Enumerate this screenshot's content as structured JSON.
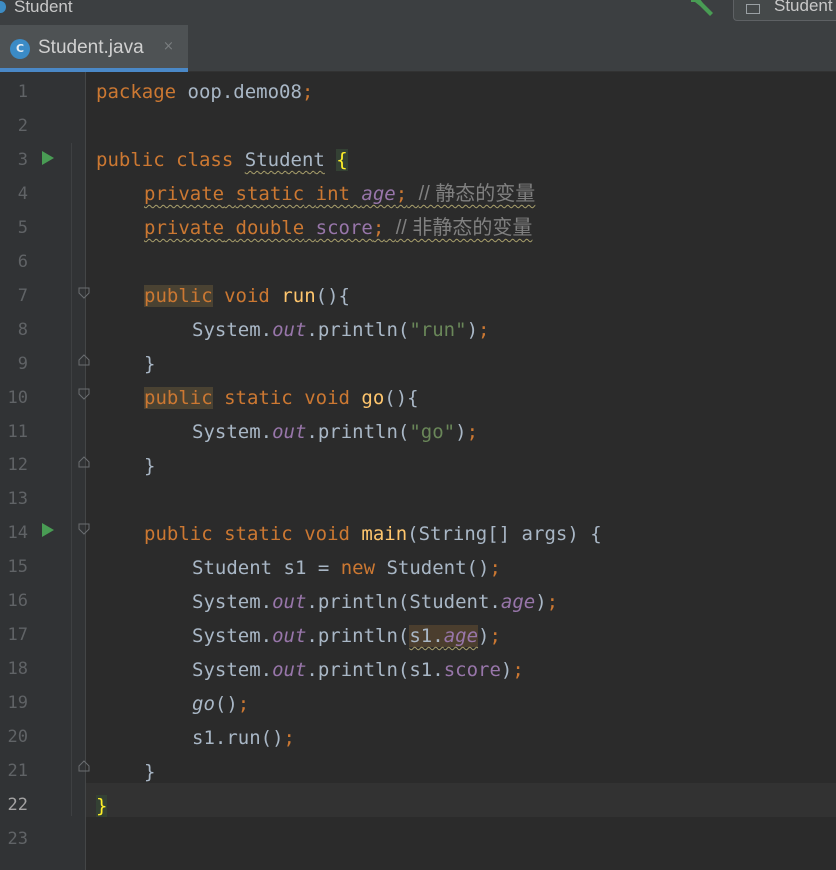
{
  "titlebar": {
    "project_title": "Student",
    "run_config_label": "Student"
  },
  "editor_tab": {
    "label": "Student.java",
    "icon_letter": "C",
    "close_glyph": "×"
  },
  "colors": {
    "background": "#2b2b2b",
    "keyword": "#cc7832",
    "method_decl": "#ffc66d",
    "string": "#6a8759",
    "static_field": "#9876aa",
    "comment": "#808080",
    "default_text": "#a9b7c6",
    "run_gutter": "#499c54"
  },
  "icons": [
    "hammer-icon",
    "run-config-icon",
    "java-class-icon",
    "close-icon",
    "run-icon",
    "fold-icon"
  ],
  "line_numbers": [
    "1",
    "2",
    "3",
    "4",
    "5",
    "6",
    "7",
    "8",
    "9",
    "10",
    "11",
    "12",
    "13",
    "14",
    "15",
    "16",
    "17",
    "18",
    "19",
    "20",
    "21",
    "22",
    "23"
  ],
  "current_line": "22",
  "code": {
    "l1": {
      "kw": "package",
      "rest": " oop.demo08",
      "semi": ";"
    },
    "l3": {
      "kw1": "public",
      "kw2": "class",
      "name": "Student",
      "brace": "{"
    },
    "l4": {
      "kw1": "private",
      "kw2": "static",
      "kw3": "int",
      "field": "age",
      "semi": ";",
      "comment": "// 静态的变量"
    },
    "l5": {
      "kw1": "private",
      "kw2": "double",
      "field": "score",
      "semi": ";",
      "comment": "// 非静态的变量"
    },
    "l7": {
      "kw1": "public",
      "kw2": "void",
      "method": "run",
      "rest": "(){"
    },
    "l8": {
      "pre": "System.",
      "out": "out",
      "mid": ".println(",
      "str": "\"run\"",
      "close": ")",
      "semi": ";"
    },
    "l9": {
      "text": "}"
    },
    "l10": {
      "kw1": "public",
      "kw2": "static",
      "kw3": "void",
      "method": "go",
      "rest": "(){"
    },
    "l11": {
      "pre": "System.",
      "out": "out",
      "mid": ".println(",
      "str": "\"go\"",
      "close": ")",
      "semi": ";"
    },
    "l12": {
      "text": "}"
    },
    "l14": {
      "kw1": "public",
      "kw2": "static",
      "kw3": "void",
      "method": "main",
      "rest": "(String[] args) {"
    },
    "l15": {
      "pre": "Student s1 = ",
      "kw": "new",
      "rest": " Student()",
      "semi": ";"
    },
    "l16": {
      "pre": "System.",
      "out": "out",
      "mid": ".println(Student.",
      "field": "age",
      "close": ")",
      "semi": ";"
    },
    "l17": {
      "pre": "System.",
      "out": "out",
      "mid": ".println(",
      "obj": "s1.",
      "field": "age",
      "close": ")",
      "semi": ";"
    },
    "l18": {
      "pre": "System.",
      "out": "out",
      "mid": ".println(s1.",
      "field": "score",
      "close": ")",
      "semi": ";"
    },
    "l19": {
      "call": "go",
      "rest": "()",
      "semi": ";"
    },
    "l20": {
      "rest": "s1.run()",
      "semi": ";"
    },
    "l21": {
      "text": "}"
    },
    "l22": {
      "text": "}"
    }
  }
}
